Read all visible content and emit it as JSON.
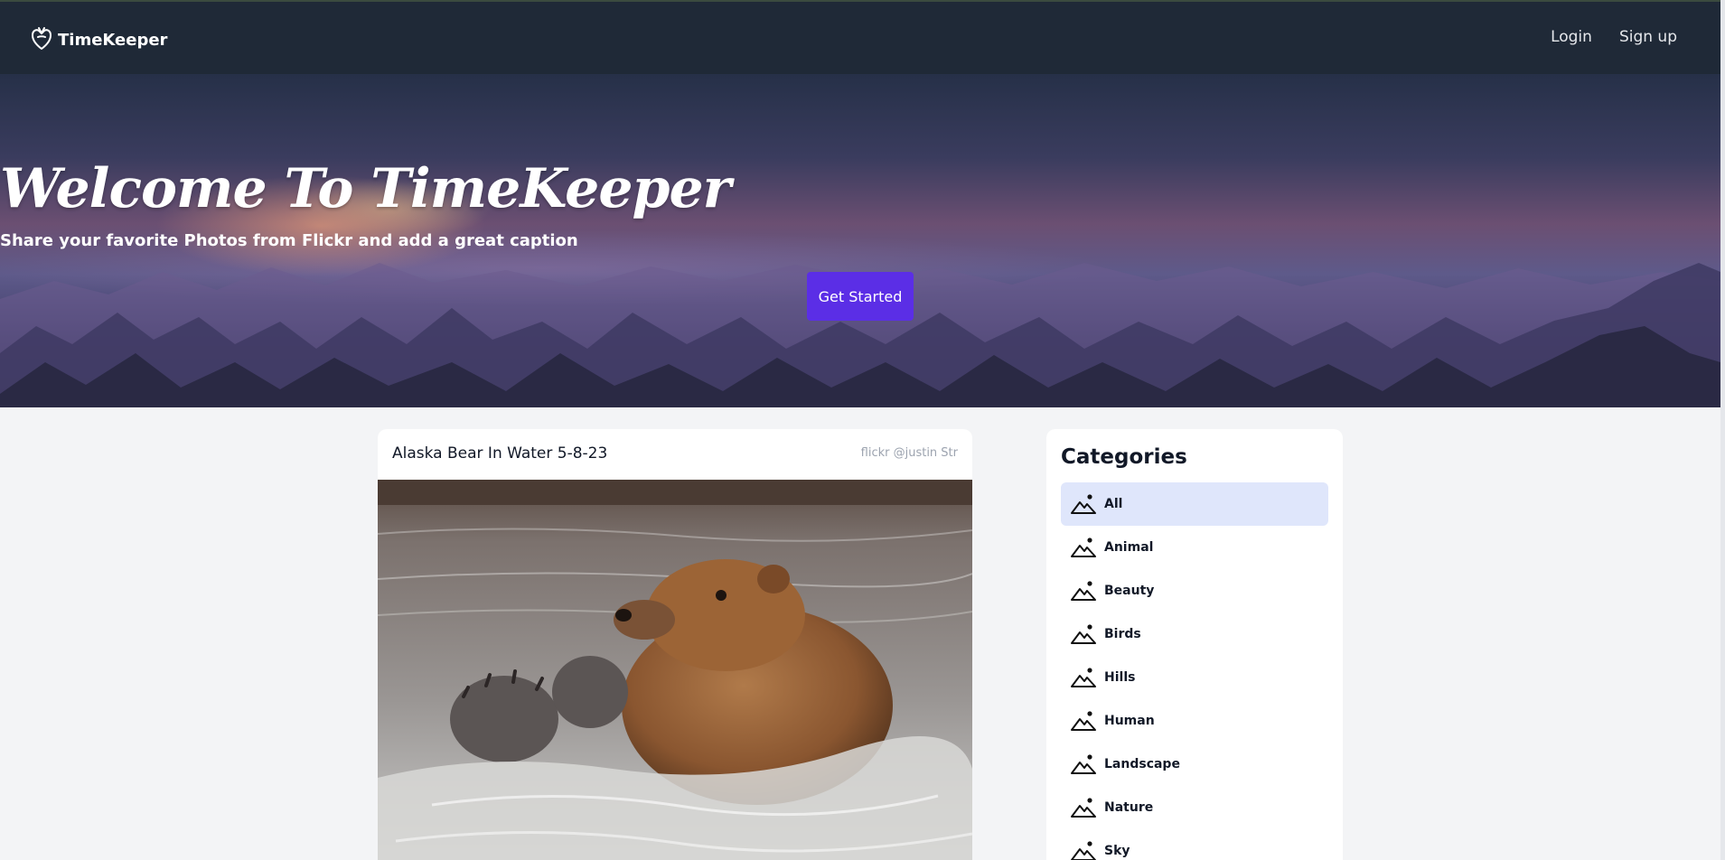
{
  "header": {
    "brand": "TimeKeeper",
    "nav": {
      "login": "Login",
      "signup": "Sign up"
    }
  },
  "hero": {
    "title": "Welcome To TimeKeeper",
    "subtitle": "Share your favorite Photos from Flickr and add a great caption",
    "cta": "Get Started"
  },
  "post": {
    "title": "Alaska Bear In Water 5-8-23",
    "source": "flickr @justin Str",
    "image_icon": "bear-in-water-photo"
  },
  "categories": {
    "title": "Categories",
    "items": [
      {
        "label": "All",
        "active": true
      },
      {
        "label": "Animal"
      },
      {
        "label": "Beauty"
      },
      {
        "label": "Birds"
      },
      {
        "label": "Hills"
      },
      {
        "label": "Human"
      },
      {
        "label": "Landscape"
      },
      {
        "label": "Nature"
      },
      {
        "label": "Sky"
      }
    ]
  },
  "colors": {
    "navbar": "#1f2937",
    "accent": "#5b2ee6",
    "active_category": "#dfe6fb",
    "page_bg": "#f3f4f6"
  }
}
